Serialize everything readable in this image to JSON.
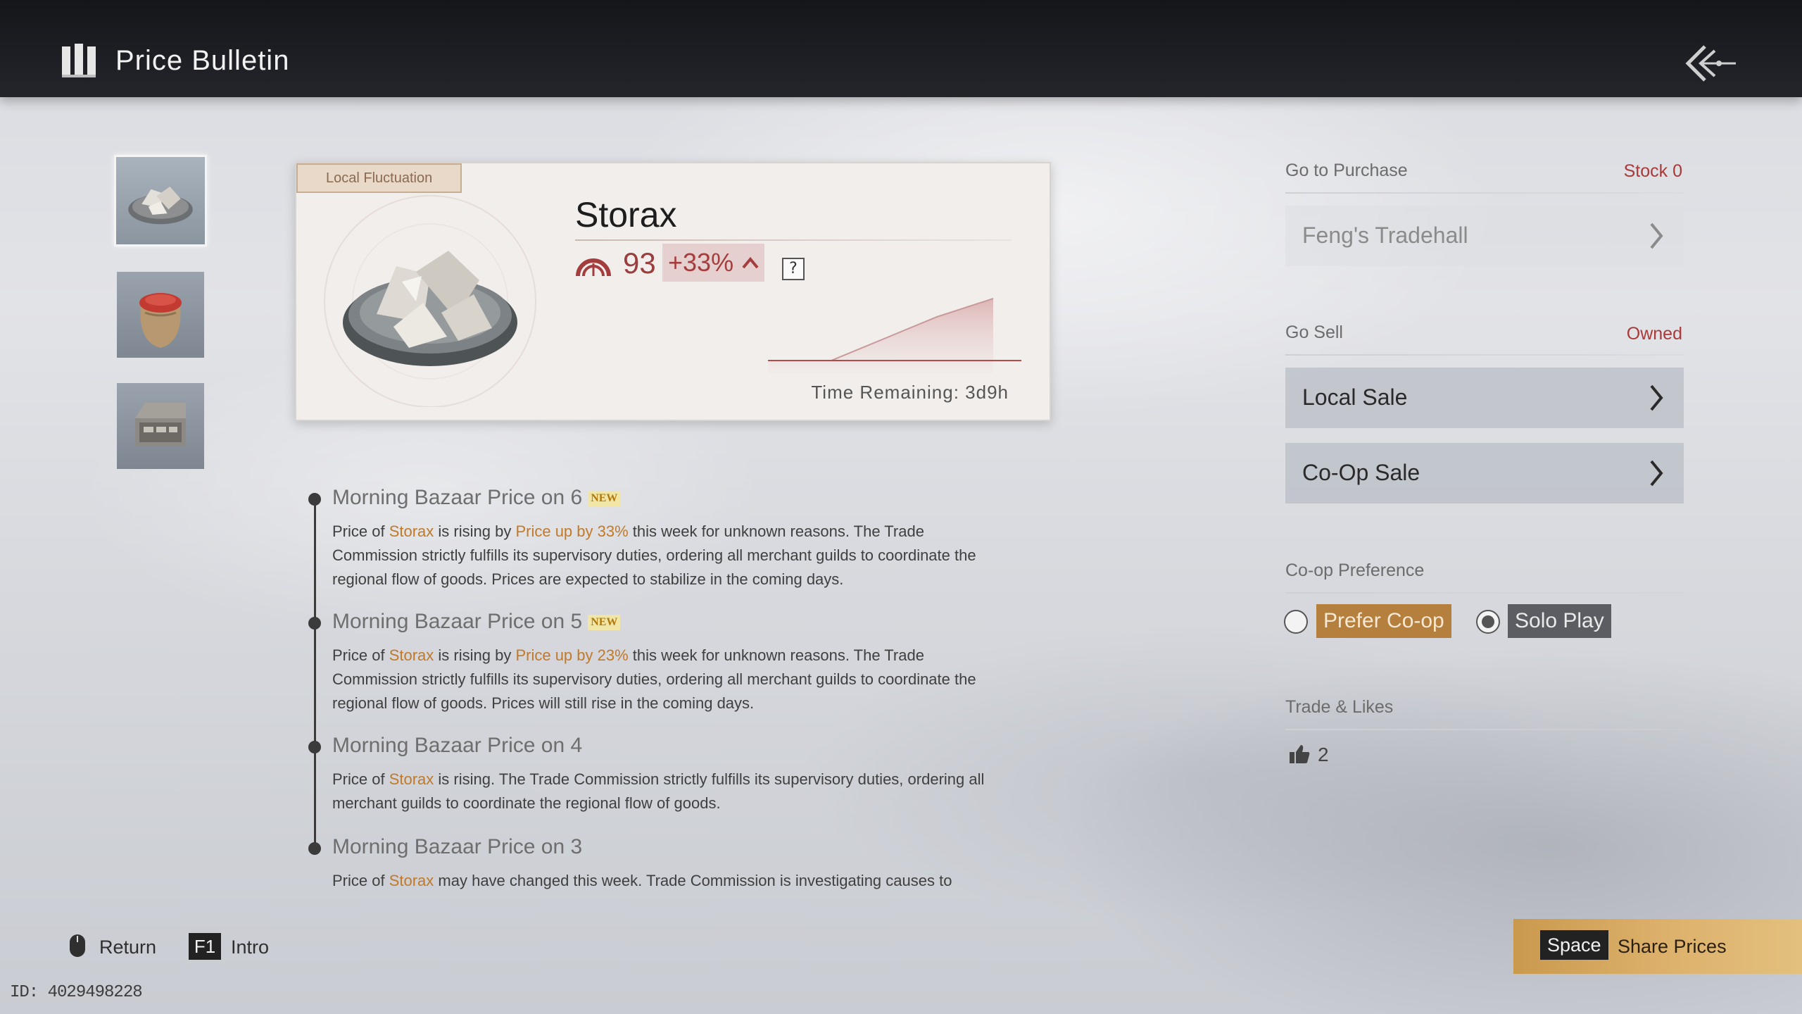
{
  "header": {
    "title": "Price Bulletin",
    "icons": {
      "title_icon": "book-icon",
      "back_icon": "back-arrow-icon"
    }
  },
  "thumbnails": [
    {
      "name": "storax-thumbnail",
      "selected": true
    },
    {
      "name": "spice-sack-thumbnail",
      "selected": false
    },
    {
      "name": "chest-thumbnail",
      "selected": false
    }
  ],
  "item": {
    "badge": "Local Fluctuation",
    "name": "Storax",
    "price": "93",
    "change": "+33%",
    "help": "?",
    "time_remaining": "Time Remaining: 3d9h",
    "trend_color": "#a43e3e"
  },
  "news": [
    {
      "heading": "Morning Bazaar Price on 6",
      "new_tag": "NEW",
      "body": [
        {
          "t": "Price of "
        },
        {
          "t": "Storax",
          "hl": true
        },
        {
          "t": " is rising by "
        },
        {
          "t": "Price up by 33%",
          "hl": true
        },
        {
          "t": " this week for unknown reasons. The Trade Commission strictly fulfills its supervisory duties, ordering all merchant guilds to coordinate the regional flow of goods. Prices are expected to stabilize in the coming days."
        }
      ]
    },
    {
      "heading": "Morning Bazaar Price on 5",
      "new_tag": "NEW",
      "body": [
        {
          "t": "Price of "
        },
        {
          "t": "Storax",
          "hl": true
        },
        {
          "t": " is rising by "
        },
        {
          "t": "Price up by 23%",
          "hl": true
        },
        {
          "t": " this week for unknown reasons. The Trade Commission strictly fulfills its supervisory duties, ordering all merchant guilds to coordinate the regional flow of goods. Prices will still rise in the coming days."
        }
      ]
    },
    {
      "heading": "Morning Bazaar Price on 4",
      "new_tag": "",
      "body": [
        {
          "t": "Price of "
        },
        {
          "t": "Storax",
          "hl": true
        },
        {
          "t": " is rising. The Trade Commission strictly fulfills its supervisory duties, ordering all merchant guilds to coordinate the regional flow of goods."
        }
      ]
    },
    {
      "heading": "Morning Bazaar Price on 3",
      "new_tag": "",
      "body": [
        {
          "t": "Price of "
        },
        {
          "t": "Storax",
          "hl": true
        },
        {
          "t": " may have changed this week. Trade Commission is investigating causes to"
        }
      ]
    }
  ],
  "purchase": {
    "label": "Go to Purchase",
    "stock": "Stock 0",
    "shop": "Feng's Tradehall"
  },
  "sell": {
    "label": "Go Sell",
    "owned": "Owned",
    "local_sale": "Local Sale",
    "coop_sale": "Co-Op Sale"
  },
  "coop_preference": {
    "label": "Co-op Preference",
    "options": [
      {
        "label": "Prefer Co-op",
        "checked": false
      },
      {
        "label": "Solo Play",
        "checked": true
      }
    ]
  },
  "likes": {
    "label": "Trade & Likes",
    "count": "2",
    "icon": "thumbs-up-icon"
  },
  "footer": {
    "return_label": "Return",
    "intro_key": "F1",
    "intro_label": "Intro",
    "share_key": "Space",
    "share_label": "Share Prices",
    "uid": "ID: 4029498228"
  },
  "colors": {
    "accent_gold": "#c9994e",
    "price_red": "#a43e3e",
    "highlight_orange": "#c1792a",
    "topbar": "#1b1c20"
  }
}
